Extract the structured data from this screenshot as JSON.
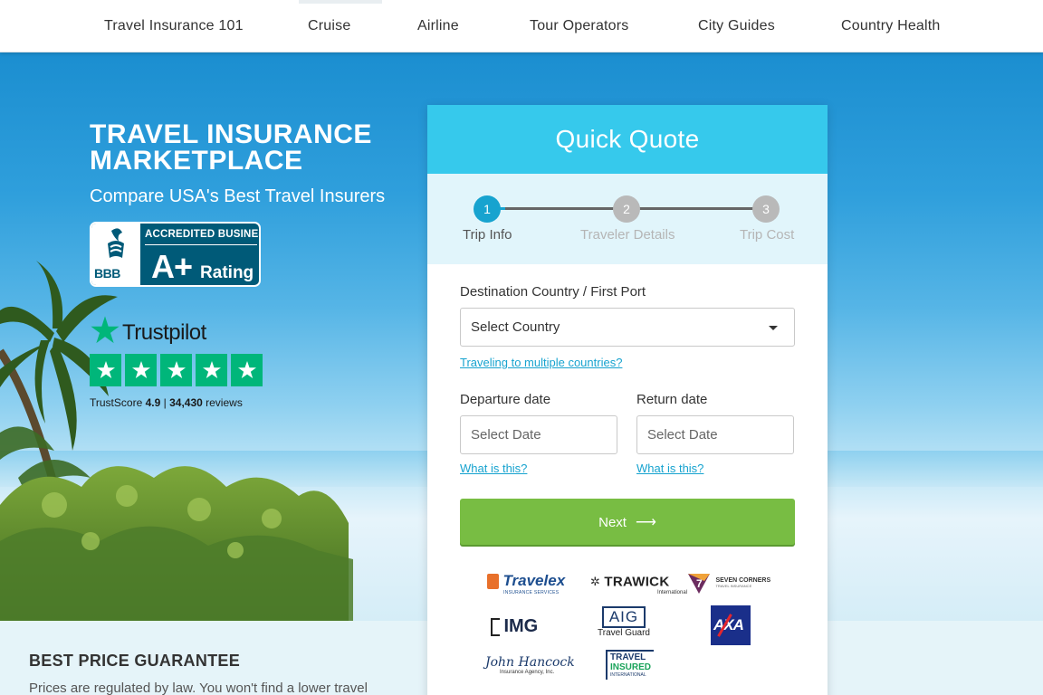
{
  "nav": {
    "items": [
      "Travel Insurance 101",
      "Cruise",
      "Airline",
      "Tour Operators",
      "City Guides",
      "Country Health"
    ]
  },
  "hero": {
    "title": "TRAVEL INSURANCE MARKETPLACE",
    "subtitle": "Compare USA's Best Travel Insurers",
    "bbb": {
      "badge_word": "BBB",
      "accredited": "ACCREDITED BUSINESS",
      "grade": "A+",
      "rating_word": "Rating"
    },
    "trustpilot": {
      "name": "Trustpilot",
      "stars": 5,
      "score_label": "TrustScore",
      "score": "4.9",
      "separator": "|",
      "review_count": "34,430",
      "reviews_label": "reviews"
    }
  },
  "quote": {
    "title": "Quick Quote",
    "steps": [
      {
        "num": "1",
        "label": "Trip Info",
        "active": true
      },
      {
        "num": "2",
        "label": "Traveler Details",
        "active": false
      },
      {
        "num": "3",
        "label": "Trip Cost",
        "active": false
      }
    ],
    "destination": {
      "label": "Destination Country / First Port",
      "value": "Select Country",
      "multi_link": "Traveling to multiple countries?"
    },
    "departure": {
      "label": "Departure date",
      "placeholder": "Select Date",
      "help_link": "What is this?"
    },
    "return": {
      "label": "Return date",
      "placeholder": "Select Date",
      "help_link": "What is this?"
    },
    "next_label": "Next",
    "next_arrow": "⟶",
    "insurers": {
      "travelex": {
        "name": "Travelex",
        "sub": "INSURANCE SERVICES"
      },
      "trawick": {
        "name": "TRAWICK",
        "sub": "International"
      },
      "seven_corners": {
        "name": "SEVEN CORNERS",
        "sub": "TRAVEL INSURANCE",
        "mark": "7"
      },
      "img": {
        "name": "IMG"
      },
      "aig": {
        "name": "AIG",
        "sub": "Travel Guard"
      },
      "axa": {
        "name": "AXA"
      },
      "john_hancock": {
        "name": "John Hancock",
        "sub": "Insurance Agency, Inc."
      },
      "travel_insured": {
        "line1": "TRAVEL",
        "line2": "INSURED",
        "line3": "INTERNATIONAL"
      }
    }
  },
  "guarantee": {
    "title": "BEST PRICE GUARANTEE",
    "text": "Prices are regulated by law. You won't find a lower travel"
  },
  "colors": {
    "header_cyan": "#36c9ec",
    "active_step": "#17a3cf",
    "inactive_step": "#b9b9b9",
    "next_green": "#78bd43",
    "trustpilot_green": "#00b67a",
    "bbb_blue": "#005a78",
    "link_blue": "#17a3cf"
  }
}
